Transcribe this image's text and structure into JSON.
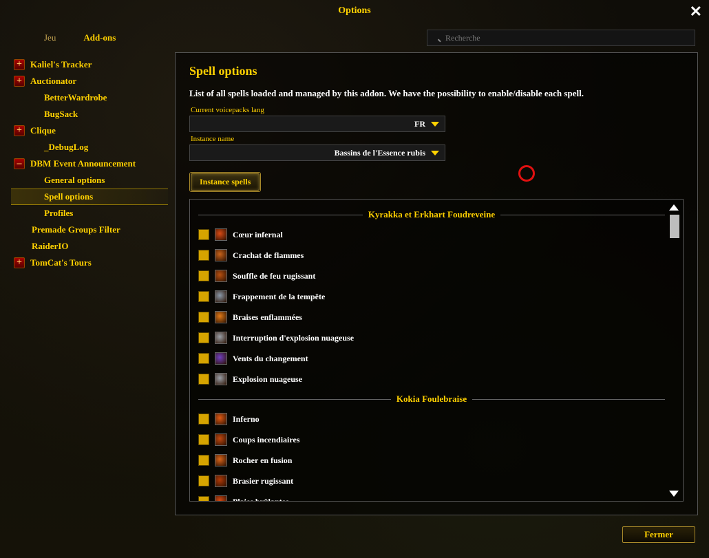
{
  "window": {
    "title": "Options"
  },
  "search": {
    "placeholder": "Recherche"
  },
  "tabs": {
    "game": "Jeu",
    "addons": "Add-ons"
  },
  "sidebar": [
    {
      "label": "Kaliel's Tracker",
      "expander": "+",
      "sub": []
    },
    {
      "label": "Auctionator",
      "expander": "+",
      "sub": [
        "BetterWardrobe",
        "BugSack"
      ]
    },
    {
      "label": "Clique",
      "expander": "+",
      "sub": [
        "_DebugLog"
      ]
    },
    {
      "label": "DBM Event Announcement",
      "expander": "–",
      "sub": [
        "General options",
        "Spell options",
        "Profiles"
      ],
      "selected_sub": 1,
      "followups": [
        "Premade Groups Filter",
        "RaiderIO"
      ]
    },
    {
      "label": "TomCat's Tours",
      "expander": "+",
      "sub": []
    }
  ],
  "panel": {
    "title": "Spell options",
    "desc": "List of all spells loaded and managed by this addon. We have the possibility to enable/disable each spell.",
    "lang_label": "Current voicepacks lang",
    "lang_value": "FR",
    "instance_label": "Instance name",
    "instance_value": "Bassins de l'Essence rubis",
    "instance_spells_btn": "Instance spells"
  },
  "spell_groups": [
    {
      "name": "Kyrakka et Erkhart Foudreveine",
      "spells": [
        {
          "name": "Cœur infernal",
          "icon": "#d94a14"
        },
        {
          "name": "Crachat de flammes",
          "icon": "#c9631a"
        },
        {
          "name": "Souffle de feu rugissant",
          "icon": "#b85010"
        },
        {
          "name": "Frappement de la tempête",
          "icon": "#8a99aa"
        },
        {
          "name": "Braises enflammées",
          "icon": "#e27a18"
        },
        {
          "name": "Interruption d'explosion nuageuse",
          "icon": "#9aa0a8"
        },
        {
          "name": "Vents du changement",
          "icon": "#7040c0"
        },
        {
          "name": "Explosion nuageuse",
          "icon": "#9aa0a8"
        }
      ]
    },
    {
      "name": "Kokia Foulebraise",
      "spells": [
        {
          "name": "Inferno",
          "icon": "#e05a14"
        },
        {
          "name": "Coups incendiaires",
          "icon": "#c04810"
        },
        {
          "name": "Rocher en fusion",
          "icon": "#d9641a"
        },
        {
          "name": "Brasier rugissant",
          "icon": "#b03a08"
        },
        {
          "name": "Plaies brûlantes",
          "icon": "#d94a14"
        }
      ]
    }
  ],
  "footer": {
    "close": "Fermer"
  }
}
